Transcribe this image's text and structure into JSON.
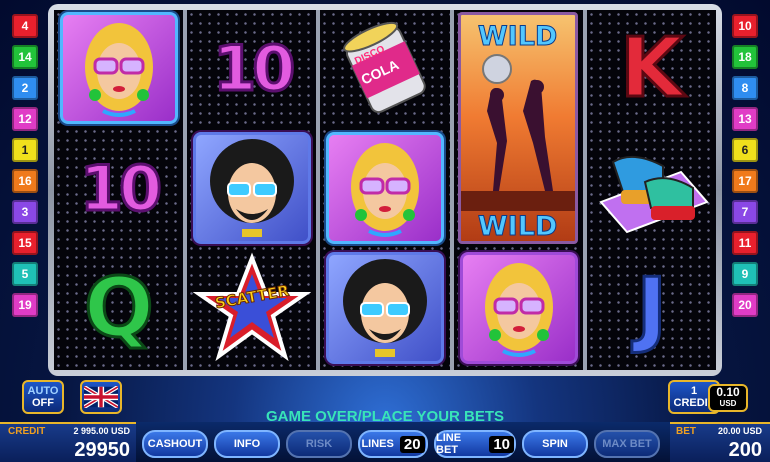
{
  "paylines_left": [
    {
      "n": "4",
      "c": "c-red"
    },
    {
      "n": "14",
      "c": "c-green"
    },
    {
      "n": "2",
      "c": "c-blue"
    },
    {
      "n": "12",
      "c": "c-pink"
    },
    {
      "n": "1",
      "c": "c-yellow"
    },
    {
      "n": "16",
      "c": "c-orange"
    },
    {
      "n": "3",
      "c": "c-purple"
    },
    {
      "n": "15",
      "c": "c-red"
    },
    {
      "n": "5",
      "c": "c-teal"
    },
    {
      "n": "19",
      "c": "c-pink"
    }
  ],
  "paylines_right": [
    {
      "n": "10",
      "c": "c-red"
    },
    {
      "n": "18",
      "c": "c-green"
    },
    {
      "n": "8",
      "c": "c-blue"
    },
    {
      "n": "13",
      "c": "c-pink"
    },
    {
      "n": "6",
      "c": "c-yellow"
    },
    {
      "n": "17",
      "c": "c-orange"
    },
    {
      "n": "7",
      "c": "c-purple"
    },
    {
      "n": "11",
      "c": "c-red"
    },
    {
      "n": "9",
      "c": "c-teal"
    },
    {
      "n": "20",
      "c": "c-pink"
    }
  ],
  "reels": [
    [
      "blonde-girl",
      "10",
      "Q"
    ],
    [
      "10",
      "afro-man",
      "scatter-star"
    ],
    [
      "disco-cola-can",
      "blonde-girl",
      "afro-man"
    ],
    [
      "wild",
      "wild",
      "blonde-girl"
    ],
    [
      "K",
      "platform-shoes",
      "J"
    ]
  ],
  "symbols": {
    "ten": "10",
    "queen": "Q",
    "king": "K",
    "jack": "J",
    "wild_top": "WILD",
    "wild_bottom": "WILD",
    "scatter": "SCATTER",
    "cola_line1": "DISCO",
    "cola_line2": "COLA"
  },
  "controls": {
    "auto_line1": "AUTO",
    "auto_line2": "OFF",
    "flag": "uk-flag",
    "credit_denom_line1": "1",
    "credit_denom_line2": "CREDIT",
    "denom_value": "0.10",
    "denom_currency": "USD"
  },
  "status": "GAME OVER/PLACE YOUR BETS",
  "credit": {
    "label": "CREDIT",
    "usd": "2 995.00 USD",
    "value": "29950"
  },
  "bet": {
    "label": "BET",
    "usd": "20.00 USD",
    "value": "200"
  },
  "buttons": {
    "cashout": "CASHOUT",
    "info": "INFO",
    "risk": "RISK",
    "lines": "LINES",
    "lines_value": "20",
    "line_bet": "LINE BET",
    "line_bet_value": "10",
    "spin": "SPIN",
    "max_bet": "MAX BET"
  },
  "colors": {
    "frame_gold": "#e8b62a",
    "status_green": "#38e4b8",
    "credit_orange": "#f0a020"
  }
}
